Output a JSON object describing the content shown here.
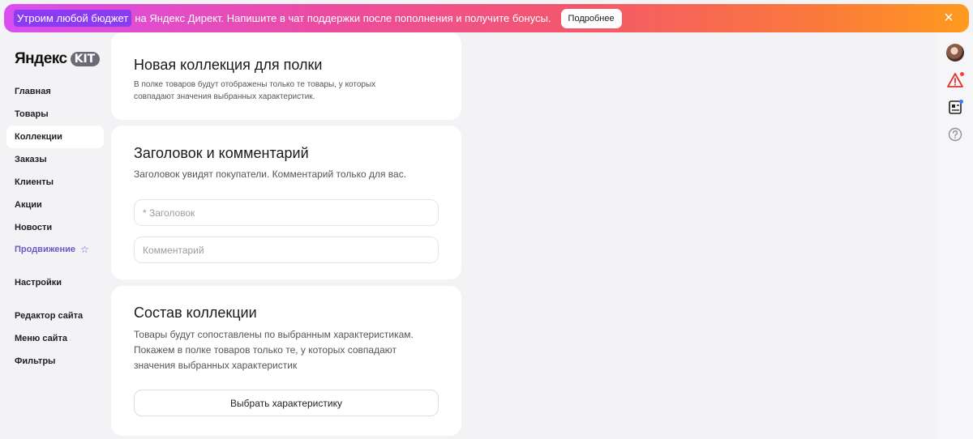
{
  "banner": {
    "highlight": "Утроим любой бюджет",
    "text": "на Яндекс Директ. Напишите в чат поддержки после пополнения и получите бонусы.",
    "button_label": "Подробнее",
    "close_icon": "×"
  },
  "logo": {
    "word": "Яндекс",
    "badge": "KIT"
  },
  "sidebar": {
    "items": [
      {
        "label": "Главная"
      },
      {
        "label": "Товары"
      },
      {
        "label": "Коллекции",
        "active": true
      },
      {
        "label": "Заказы"
      },
      {
        "label": "Клиенты"
      },
      {
        "label": "Акции"
      },
      {
        "label": "Новости"
      },
      {
        "label": "Продвижение",
        "icon": "star-icon"
      },
      {
        "label": "Настройки"
      },
      {
        "label": "Редактор сайта"
      },
      {
        "label": "Меню сайта"
      },
      {
        "label": "Фильтры"
      }
    ]
  },
  "header_card": {
    "title": "Новая коллекция для полки",
    "description_line1": "В полке товаров будут отображены только те товары, у которых",
    "description_line2": "совпадают значения выбранных характеристик."
  },
  "title_card": {
    "title": "Заголовок и комментарий",
    "description": "Заголовок увидят покупатели. Комментарий только для вас.",
    "title_placeholder": "* Заголовок",
    "comment_placeholder": "Комментарий"
  },
  "composition_card": {
    "title": "Состав коллекции",
    "description_line1": "Товары будут сопоставлены по выбранным характеристикам.",
    "description_line2": "Покажем в полке товаров только те, у которых совпадают",
    "description_line3": "значения выбранных характеристик",
    "button_label": "Выбрать характеристику"
  },
  "right_rail": {
    "icons": [
      "avatar",
      "alert-icon",
      "news-icon",
      "help-icon"
    ],
    "alert_dot_color": "#ff3b30",
    "news_dot_color": "#3d7bfd"
  },
  "colors": {
    "banner_gradient_start": "#d94ef0",
    "banner_gradient_end": "#ff9a1f",
    "highlight": "#8b3cf2",
    "promo_accent": "#6b58c8"
  }
}
